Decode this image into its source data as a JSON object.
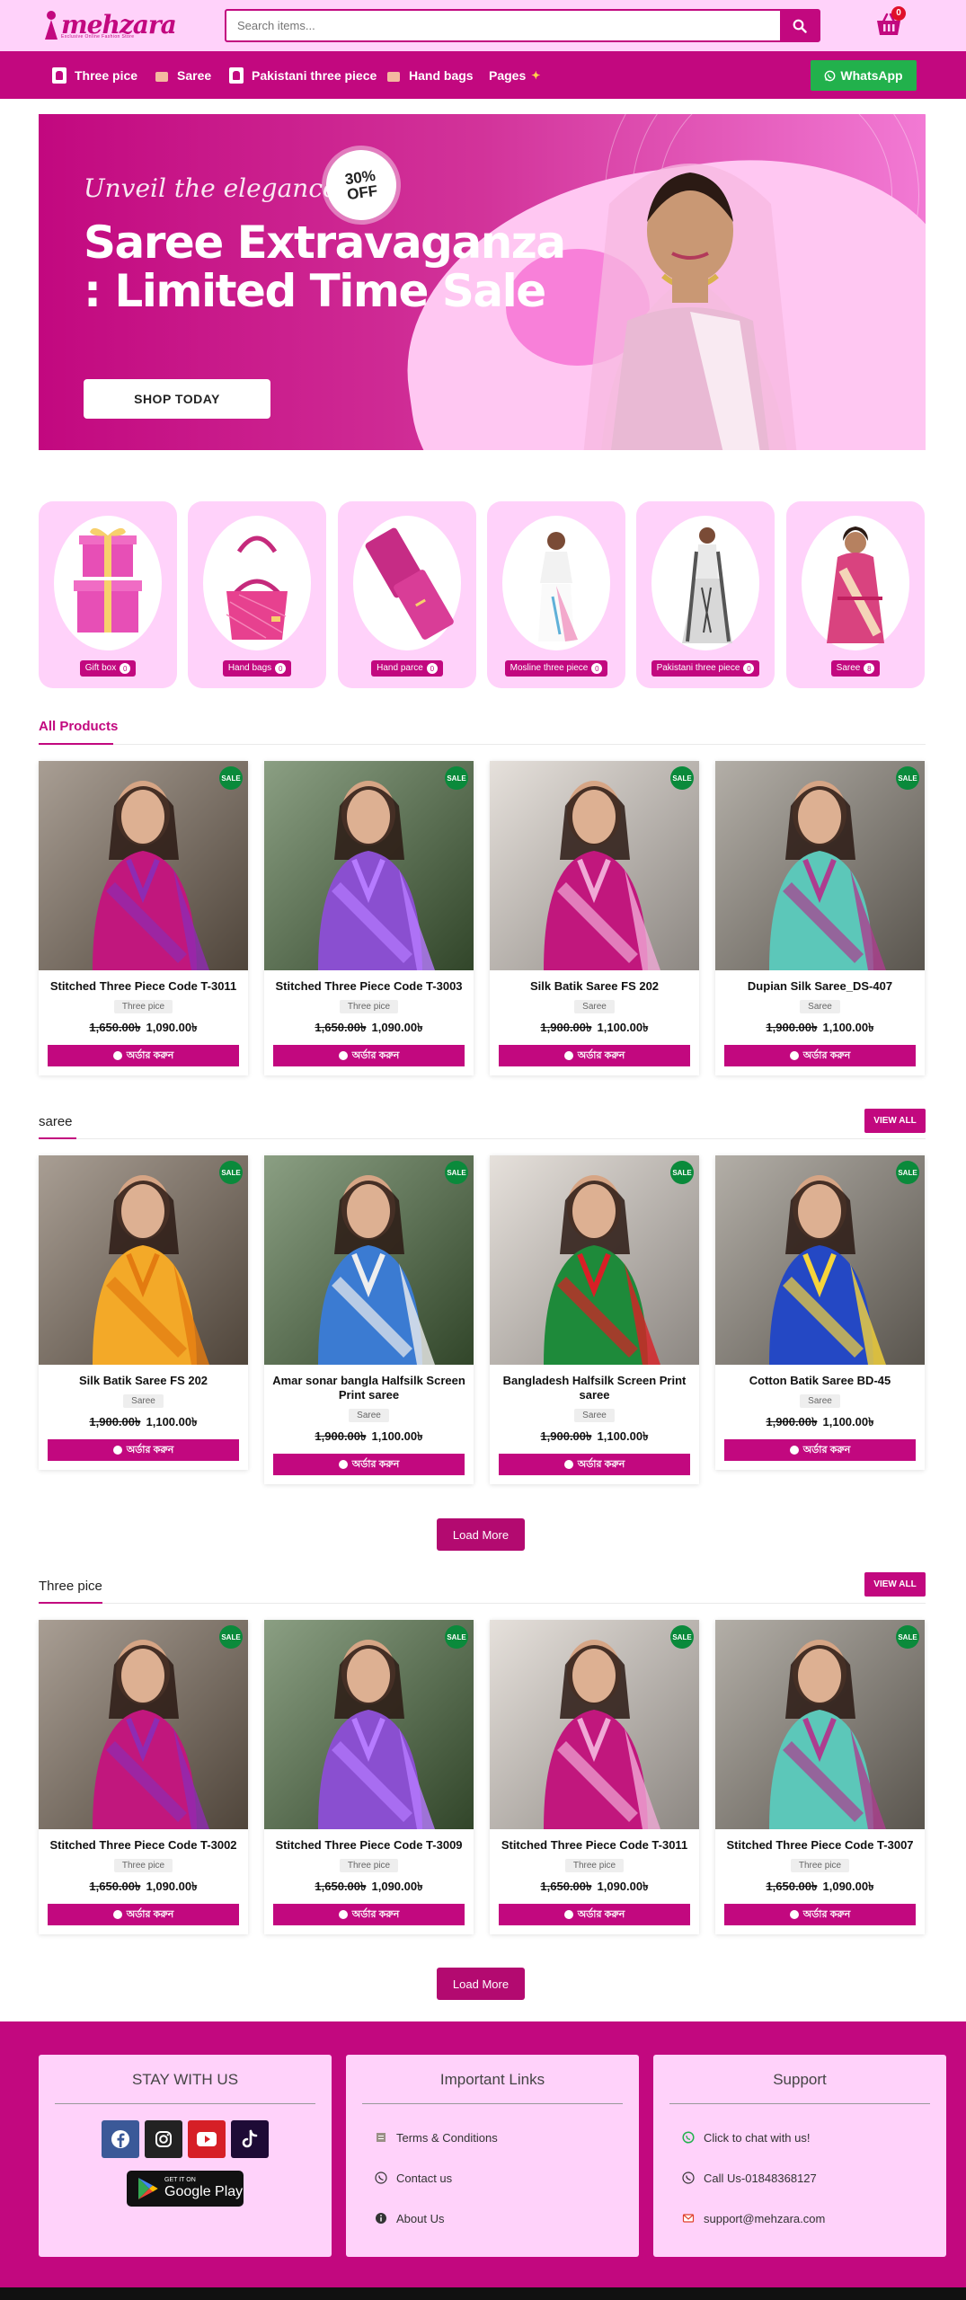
{
  "brand": {
    "name": "mehzara",
    "tagline": "Exclusive Online Fashion Store"
  },
  "search": {
    "placeholder": "Search items..."
  },
  "cart": {
    "count": "0"
  },
  "nav": {
    "items": [
      {
        "label": "Three pice"
      },
      {
        "label": "Saree"
      },
      {
        "label": "Pakistani three piece"
      },
      {
        "label": "Hand bags"
      },
      {
        "label": "Pages"
      }
    ],
    "whatsapp": "WhatsApp"
  },
  "hero": {
    "tagline": "Unveil the elegance",
    "title": "Saree Extravaganza : Limited Time Sale",
    "badge": "30% OFF",
    "button": "SHOP TODAY"
  },
  "categories": [
    {
      "label": "Gift box",
      "count": "0"
    },
    {
      "label": "Hand bags",
      "count": "0"
    },
    {
      "label": "Hand parce",
      "count": "0"
    },
    {
      "label": "Mosline three piece",
      "count": "0"
    },
    {
      "label": "Pakistani three piece",
      "count": "0"
    },
    {
      "label": "Saree",
      "count": "8"
    }
  ],
  "sections": {
    "all_products": {
      "title": "All Products"
    },
    "saree": {
      "title": "saree",
      "view_all": "VIEW ALL",
      "load_more": "Load More"
    },
    "three_pice": {
      "title": "Three pice",
      "view_all": "VIEW ALL",
      "load_more": "Load More"
    }
  },
  "sale_badge": "SALE",
  "order_label": "অর্ডার করুন",
  "products": {
    "all": [
      {
        "name": "Stitched Three Piece Code T-3011",
        "category": "Three pice",
        "old_price": "1,650.00৳",
        "price": "1,090.00৳"
      },
      {
        "name": "Stitched Three Piece Code T-3003",
        "category": "Three pice",
        "old_price": "1,650.00৳",
        "price": "1,090.00৳"
      },
      {
        "name": "Silk Batik Saree FS 202",
        "category": "Saree",
        "old_price": "1,900.00৳",
        "price": "1,100.00৳"
      },
      {
        "name": "Dupian Silk Saree_DS-407",
        "category": "Saree",
        "old_price": "1,900.00৳",
        "price": "1,100.00৳"
      }
    ],
    "saree": [
      {
        "name": "Silk Batik Saree FS 202",
        "category": "Saree",
        "old_price": "1,900.00৳",
        "price": "1,100.00৳"
      },
      {
        "name": "Amar sonar bangla Halfsilk Screen Print saree",
        "category": "Saree",
        "old_price": "1,900.00৳",
        "price": "1,100.00৳"
      },
      {
        "name": "Bangladesh Halfsilk Screen Print saree",
        "category": "Saree",
        "old_price": "1,900.00৳",
        "price": "1,100.00৳"
      },
      {
        "name": "Cotton Batik Saree BD-45",
        "category": "Saree",
        "old_price": "1,900.00৳",
        "price": "1,100.00৳"
      }
    ],
    "three": [
      {
        "name": "Stitched Three Piece Code T-3002",
        "category": "Three pice",
        "old_price": "1,650.00৳",
        "price": "1,090.00৳"
      },
      {
        "name": "Stitched Three Piece Code T-3009",
        "category": "Three pice",
        "old_price": "1,650.00৳",
        "price": "1,090.00৳"
      },
      {
        "name": "Stitched Three Piece Code T-3011",
        "category": "Three pice",
        "old_price": "1,650.00৳",
        "price": "1,090.00৳"
      },
      {
        "name": "Stitched Three Piece Code T-3007",
        "category": "Three pice",
        "old_price": "1,650.00৳",
        "price": "1,090.00৳"
      }
    ]
  },
  "footer": {
    "stay": {
      "title": "STAY WITH US",
      "gplay_small": "GET IT ON",
      "gplay_big": "Google Play"
    },
    "links": {
      "title": "Important Links",
      "items": [
        "Terms & Conditions",
        "Contact us",
        "About Us"
      ]
    },
    "support": {
      "title": "Support",
      "items": [
        "Click to chat with us!",
        "Call Us-01848368127",
        "support@mehzara.com"
      ]
    }
  },
  "colors": {
    "brand": "#c2087f",
    "brand_light": "#ffd2fa",
    "whatsapp": "#22b14c",
    "sale": "#0a8a3b"
  }
}
